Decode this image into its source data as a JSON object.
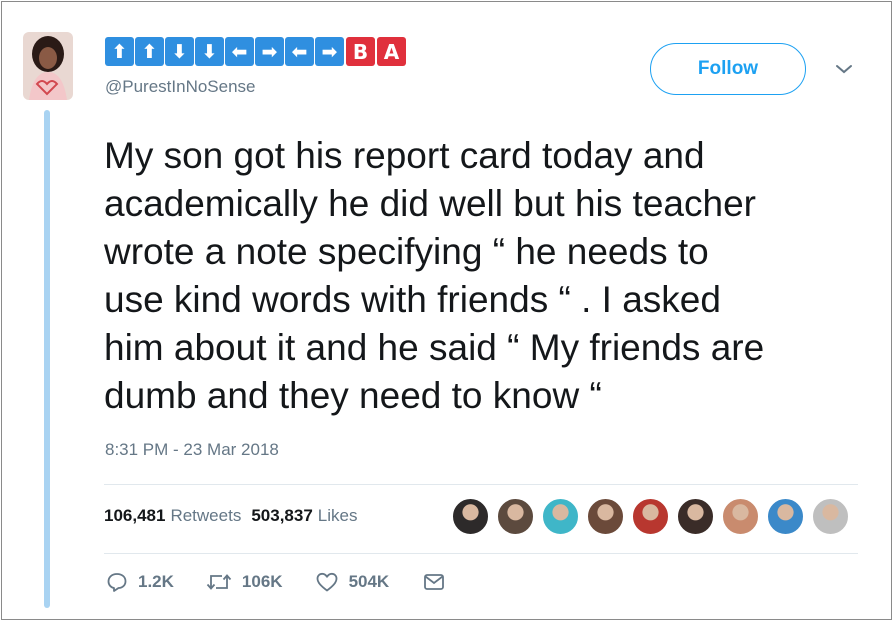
{
  "author": {
    "display_name_tiles": [
      {
        "glyph": "⬆",
        "kind": "up-arrow"
      },
      {
        "glyph": "⬆",
        "kind": "up-arrow"
      },
      {
        "glyph": "⬇",
        "kind": "down-arrow"
      },
      {
        "glyph": "⬇",
        "kind": "down-arrow"
      },
      {
        "glyph": "⬅",
        "kind": "left-arrow"
      },
      {
        "glyph": "➡",
        "kind": "right-arrow"
      },
      {
        "glyph": "⬅",
        "kind": "left-arrow"
      },
      {
        "glyph": "➡",
        "kind": "right-arrow"
      },
      {
        "glyph": "B",
        "kind": "letter-b"
      },
      {
        "glyph": "A",
        "kind": "letter-a"
      }
    ],
    "handle": "@PurestInNoSense"
  },
  "follow_label": "Follow",
  "tweet": {
    "text_lines": [
      "My son got his report card today and",
      "academically he did well but his teacher",
      "wrote a note specifying “ he needs to",
      "use kind words with friends “ . I asked",
      "him about it and he said “ My friends are",
      "dumb and they need to know “"
    ],
    "timestamp": "8:31 PM - 23 Mar 2018"
  },
  "stats": {
    "retweets_count": "106,481",
    "retweets_label": "Retweets",
    "likes_count": "503,837",
    "likes_label": "Likes"
  },
  "liker_avatar_colors": [
    "#2d2a2a",
    "#5c4a3e",
    "#3fb6c8",
    "#6b4a3a",
    "#b8372f",
    "#3a2c28",
    "#c98b6e",
    "#3b89c9",
    "#bfbfbf"
  ],
  "actions": {
    "replies": "1.2K",
    "retweets": "106K",
    "likes": "504K"
  },
  "colors": {
    "accent": "#1da1f2",
    "thread_line": "#a9d3f2",
    "tile_blue": "#2f8fe0",
    "tile_red": "#e0303c"
  }
}
